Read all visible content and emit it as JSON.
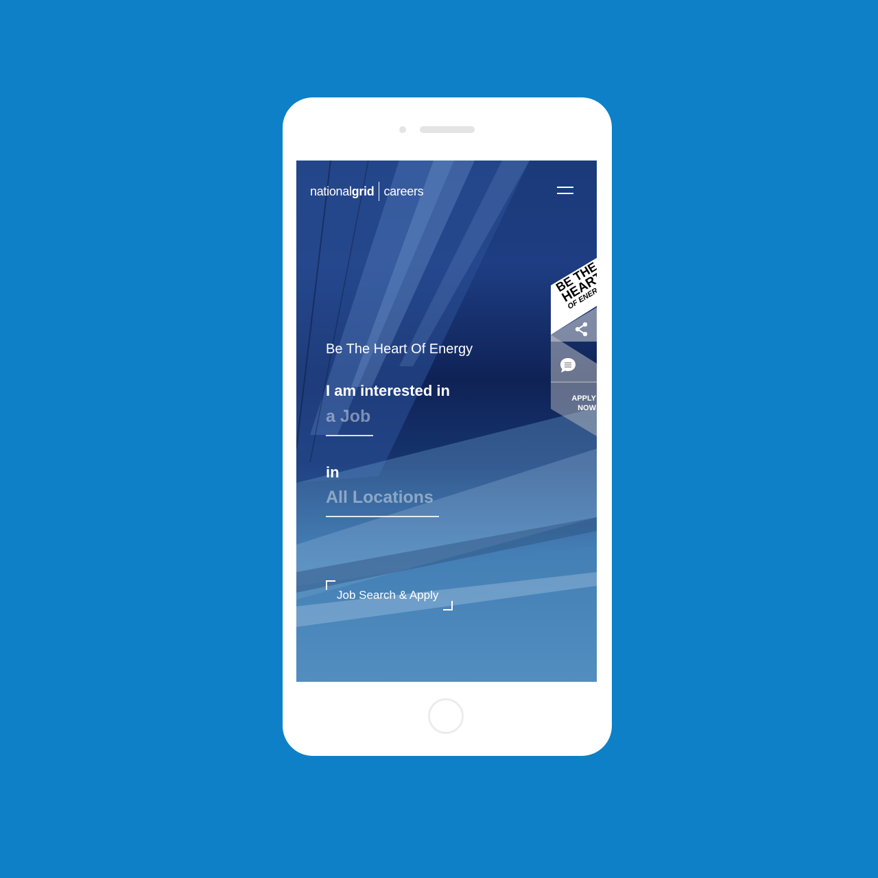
{
  "app": {
    "brand_national": "national",
    "brand_grid": "grid",
    "brand_section": "careers"
  },
  "hero": {
    "tagline": "Be The Heart Of Energy",
    "interest_prompt": "I am interested in",
    "interest_value": "a Job",
    "location_prompt": "in",
    "location_value": "All Locations",
    "cta_label": "Job Search & Apply"
  },
  "side_rail": {
    "badge_line1": "BE THE",
    "badge_line2": "HEART",
    "badge_line3": "OF ENERGY",
    "share_icon": "share-icon",
    "chat_icon": "chat-icon",
    "apply_label": "APPLY\nNOW"
  },
  "header": {
    "menu_icon": "hamburger-menu-icon"
  },
  "colors": {
    "page_background": "#0d80c7",
    "phone_body": "#ffffff",
    "text": "#ffffff"
  }
}
